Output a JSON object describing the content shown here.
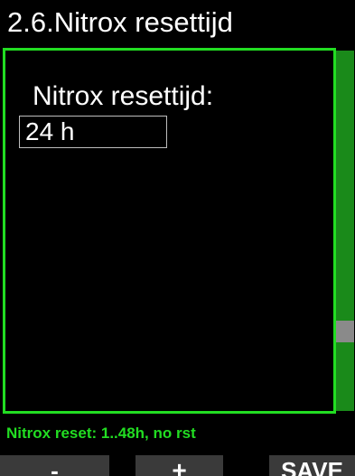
{
  "header": {
    "title": "2.6.Nitrox resettijd"
  },
  "setting": {
    "label": "Nitrox resettijd:",
    "value": "24 h"
  },
  "scrollbar": {
    "position": 0.76
  },
  "help": {
    "text": "Nitrox reset: 1..48h, no rst"
  },
  "softkeys": {
    "left_label": "-",
    "center_label": "+",
    "right_label": "SAVE"
  },
  "colors": {
    "accent": "#22dd22",
    "scroll_track": "#1a8a1a",
    "softkey_bg": "#3a3a3a",
    "background": "#000000"
  }
}
